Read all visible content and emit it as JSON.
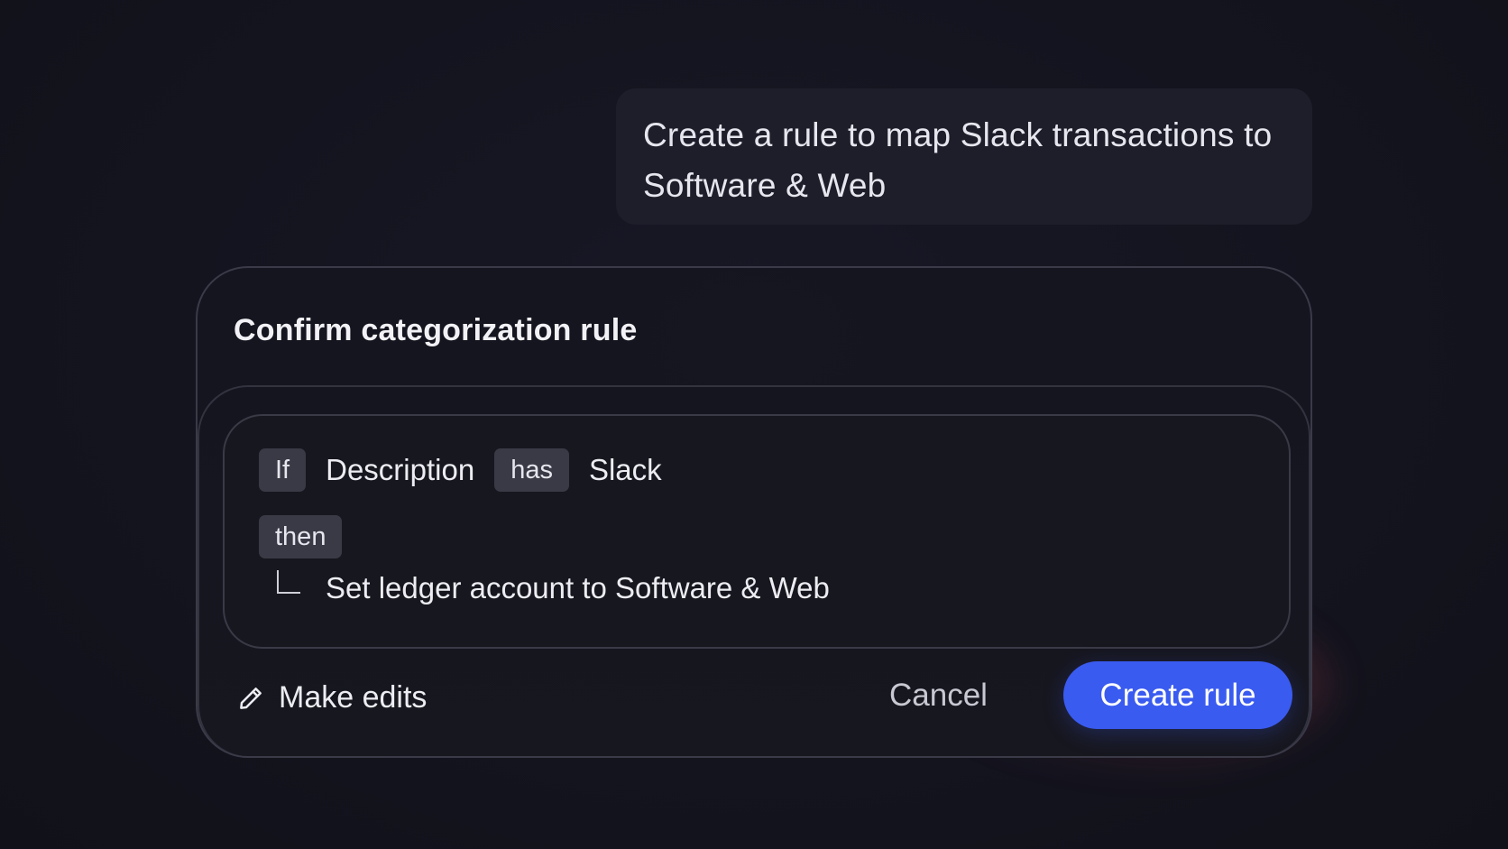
{
  "chat": {
    "user_message": "Create a rule to map Slack transactions to Software & Web"
  },
  "card": {
    "title": "Confirm categorization rule",
    "rule": {
      "if_label": "If",
      "field": "Description",
      "operator": "has",
      "value": "Slack",
      "then_label": "then",
      "action": "Set ledger account to Software & Web"
    },
    "footer": {
      "edit_label": "Make edits",
      "edit_icon": "pencil-icon",
      "cancel_label": "Cancel",
      "create_label": "Create rule"
    }
  },
  "colors": {
    "background": "#14141f",
    "accent": "#3a5bf0",
    "chip": "#3a3a46"
  }
}
